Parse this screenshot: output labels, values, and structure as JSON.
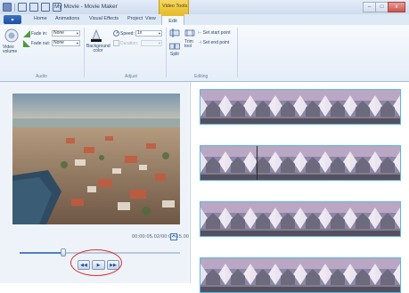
{
  "window": {
    "title": "My Movie - Movie Maker",
    "context_tab_header": "Video Tools",
    "buttons": {
      "minimize": "–",
      "maximize": "□",
      "close": "x"
    }
  },
  "tabs": {
    "file": "▾",
    "items": [
      "Home",
      "Animations",
      "Visual Effects",
      "Project",
      "View"
    ],
    "active": "Edit"
  },
  "ribbon": {
    "audio": {
      "volume_label": "Video volume",
      "fade_in_label": "Fade in:",
      "fade_in_value": "None",
      "fade_out_label": "Fade out:",
      "fade_out_value": "None",
      "group": "Audio"
    },
    "adjust": {
      "bg_color_label": "Background color",
      "speed_label": "Speed:",
      "speed_value": "1x",
      "duration_label": "Duration:",
      "group": "Adjust"
    },
    "editing": {
      "trim_tool_label": "Trim tool",
      "split_label": "Split",
      "set_start_label": "Set start point",
      "set_end_label": "Set end point",
      "group": "Editing"
    }
  },
  "preview": {
    "timecode": "00:00:05.02/00:00:15.00",
    "progress": 0.27,
    "controls": {
      "prev": "◀◀",
      "play": "▶",
      "next": "▶▶"
    }
  },
  "storyboard": {
    "strips": 4,
    "frames_per_strip": 8
  }
}
